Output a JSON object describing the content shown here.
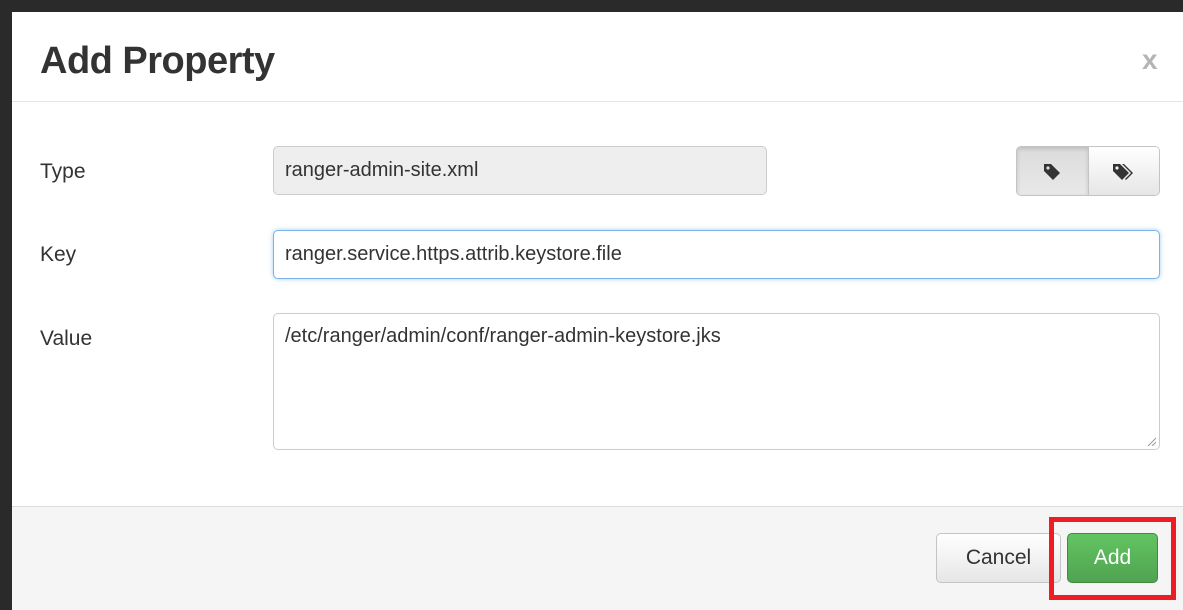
{
  "dialog": {
    "title": "Add Property",
    "close_label": "x"
  },
  "form": {
    "type_label": "Type",
    "type_value": "ranger-admin-site.xml",
    "key_label": "Key",
    "key_value": "ranger.service.https.attrib.keystore.file",
    "value_label": "Value",
    "value_value": "/etc/ranger/admin/conf/ranger-admin-keystore.jks"
  },
  "tag_buttons": [
    {
      "icon": "tag-icon",
      "active": true
    },
    {
      "icon": "tags-icon",
      "active": false
    }
  ],
  "footer": {
    "cancel_label": "Cancel",
    "add_label": "Add"
  },
  "colors": {
    "add_button": "#51a351",
    "highlight": "#ee1c24",
    "focus_border": "#7fb2e6"
  }
}
